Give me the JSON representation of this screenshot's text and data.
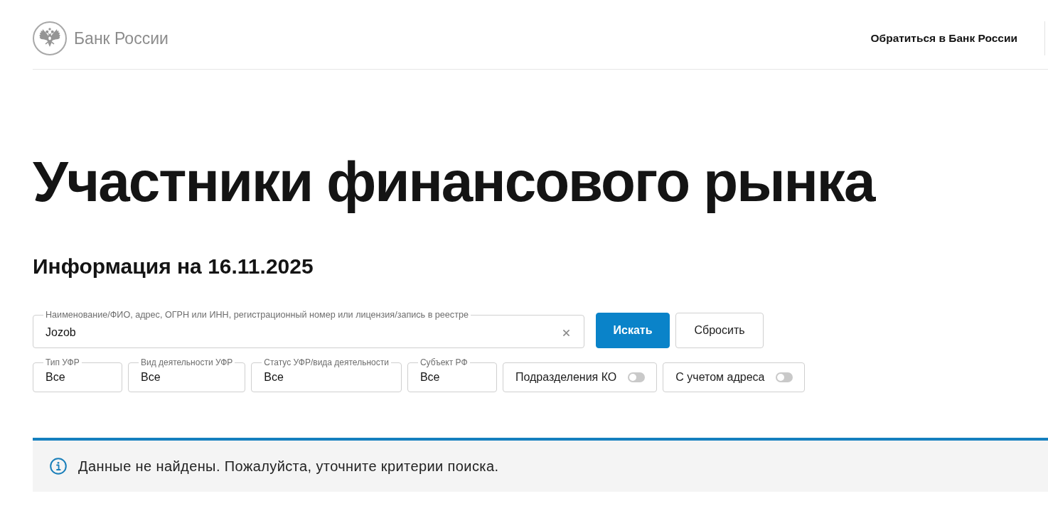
{
  "header": {
    "logo_text": "Банк России",
    "contact_link": "Обратиться в Банк России"
  },
  "title": "Участники финансового рынка",
  "subtitle": "Информация на 16.11.2025",
  "search": {
    "label": "Наименование/ФИО, адрес, ОГРН или ИНН, регистрационный номер или лицензия/запись в реестре",
    "value": "Jozob"
  },
  "buttons": [
    {
      "kind": "primary",
      "label": "Искать"
    },
    {
      "kind": "secondary",
      "label": "Сбросить"
    }
  ],
  "selects": [
    {
      "label": "Тип УФР",
      "value": "Все"
    },
    {
      "label": "Вид деятельности УФР",
      "value": "Все"
    },
    {
      "label": "Статус УФР/вида деятельности",
      "value": "Все"
    },
    {
      "label": "Субъект РФ",
      "value": "Все"
    }
  ],
  "toggles": [
    {
      "label": "Подразделения КО",
      "on": false
    },
    {
      "label": "С учетом адреса",
      "on": false
    }
  ],
  "alert": {
    "kind": "info",
    "text": "Данные не найдены. Пожалуйста, уточните критерии поиска."
  }
}
